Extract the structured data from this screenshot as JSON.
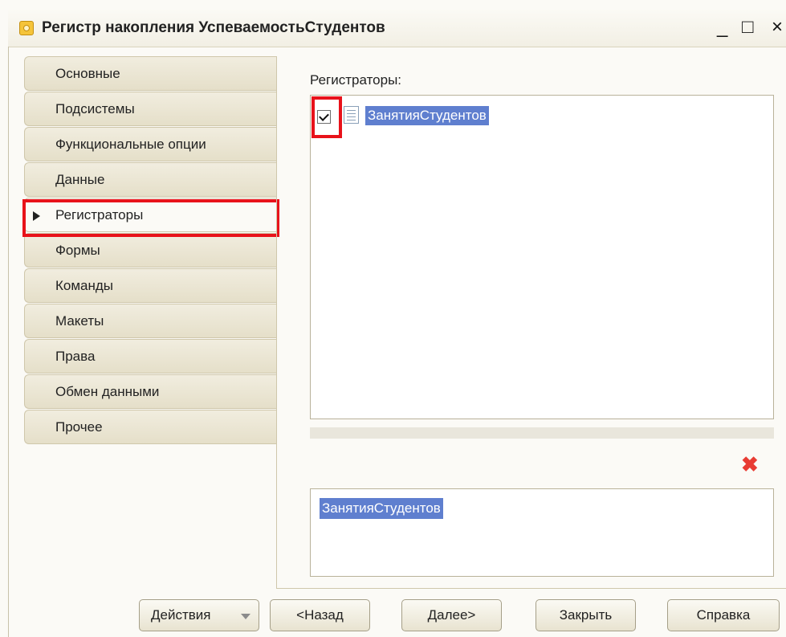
{
  "window": {
    "title": "Регистр накопления УспеваемостьСтудентов",
    "minimize": "_",
    "maximize": "□",
    "close": "×"
  },
  "nav": {
    "items": [
      {
        "label": "Основные"
      },
      {
        "label": "Подсистемы"
      },
      {
        "label": "Функциональные опции"
      },
      {
        "label": "Данные"
      },
      {
        "label": "Регистраторы",
        "active": true
      },
      {
        "label": "Формы"
      },
      {
        "label": "Команды"
      },
      {
        "label": "Макеты"
      },
      {
        "label": "Права"
      },
      {
        "label": "Обмен данными"
      },
      {
        "label": "Прочее"
      }
    ]
  },
  "registrators": {
    "label": "Регистраторы:",
    "items": [
      {
        "label": "ЗанятияСтудентов",
        "checked": true
      }
    ],
    "selected_item": "ЗанятияСтудентов"
  },
  "buttons": {
    "actions": "Действия",
    "back": "<Назад",
    "next": "Далее>",
    "close": "Закрыть",
    "help": "Справка"
  },
  "colors": {
    "highlight_outline": "#e8121a",
    "selection": "#5f7fcf",
    "delete_icon": "#e83c33"
  }
}
